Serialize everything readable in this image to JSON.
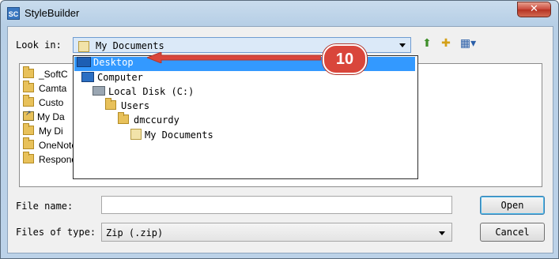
{
  "window": {
    "title": "StyleBuilder",
    "app_icon_text": "SC",
    "close_glyph": "✕"
  },
  "lookin": {
    "label": "Look in:",
    "value": "My Documents"
  },
  "toolbar": {
    "up_icon": "folder-up-icon",
    "new_folder_icon": "new-folder-icon",
    "view_icon": "view-menu-icon"
  },
  "file_list": [
    {
      "name": "_SoftC",
      "icon": "folder"
    },
    {
      "name": "Camta",
      "icon": "folder"
    },
    {
      "name": "Custo",
      "icon": "folder"
    },
    {
      "name": "My Da",
      "icon": "shortcut-folder"
    },
    {
      "name": "My Di",
      "icon": "folder"
    },
    {
      "name": "OneNote Notebooks",
      "icon": "folder"
    },
    {
      "name": "Respondus Projects",
      "icon": "folder"
    }
  ],
  "dropdown_items": [
    {
      "label": "Desktop",
      "icon": "monitor",
      "selected": true
    },
    {
      "label": "Computer",
      "icon": "computer"
    },
    {
      "label": "Local Disk (C:)",
      "icon": "disk"
    },
    {
      "label": "Users",
      "icon": "folder"
    },
    {
      "label": "dmccurdy",
      "icon": "folder"
    },
    {
      "label": "My Documents",
      "icon": "documents-folder"
    }
  ],
  "callout": {
    "number": "10",
    "color": "#d9463b"
  },
  "filename": {
    "label": "File name:",
    "value": ""
  },
  "filetype": {
    "label": "Files of type:",
    "value": "Zip (.zip)"
  },
  "buttons": {
    "open": "Open",
    "cancel": "Cancel"
  }
}
